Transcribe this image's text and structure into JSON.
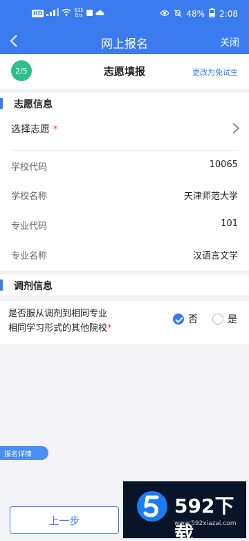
{
  "status_bar": {
    "hd_label": "HD",
    "signal_label": "⁴⁶",
    "net_speed_value": "635",
    "net_speed_unit": "B/s",
    "battery": "48%",
    "time": "2:08"
  },
  "nav": {
    "title": "网上报名",
    "close_label": "关闭"
  },
  "step": {
    "badge": "2/5",
    "title": "志愿填报",
    "switch_link": "更改为免试生"
  },
  "volunteer_section": {
    "title": "志愿信息",
    "choose_label": "选择志愿",
    "required_mark": "*",
    "fields": [
      {
        "label": "学校代码",
        "value": "10065"
      },
      {
        "label": "学校名称",
        "value": "天津师范大学"
      },
      {
        "label": "专业代码",
        "value": "101"
      },
      {
        "label": "专业名称",
        "value": "汉语言文学"
      }
    ]
  },
  "adjust_section": {
    "title": "调剂信息",
    "question_line1": "是否服从调剂到相同专业",
    "question_line2": "相同学习形式的其他院校",
    "required_mark": "*",
    "options": [
      {
        "label": "否",
        "checked": true
      },
      {
        "label": "是",
        "checked": false
      }
    ]
  },
  "detail_tab": "报名详情",
  "prev_button": "上一步",
  "watermark": {
    "brand": "592下载",
    "url": "www.592xiazai.com"
  },
  "colors": {
    "primary": "#3a7bf0",
    "step_badge": "#2fbe8c",
    "required": "#e84a4a"
  }
}
